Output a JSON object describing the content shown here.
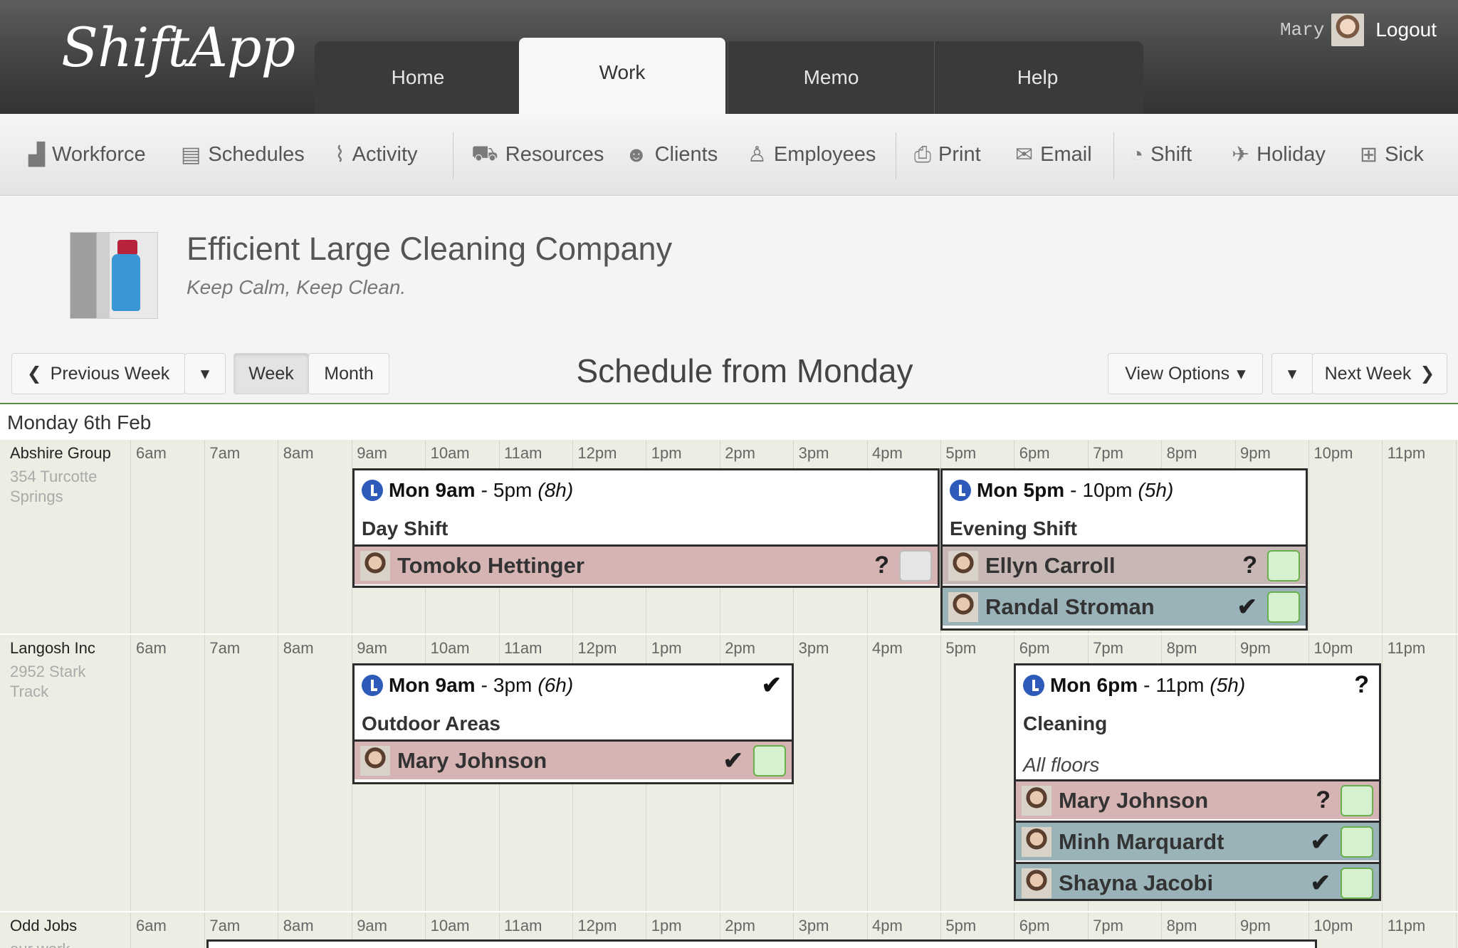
{
  "app": {
    "logo": "ShiftApp",
    "user_name": "Mary",
    "logout": "Logout"
  },
  "tabs": [
    {
      "label": "Home"
    },
    {
      "label": "Work"
    },
    {
      "label": "Memo"
    },
    {
      "label": "Help"
    }
  ],
  "toolbar": [
    {
      "label": "Workforce",
      "icon": "factory-icon"
    },
    {
      "label": "Schedules",
      "icon": "clipboard-icon"
    },
    {
      "label": "Activity",
      "icon": "pulse-icon"
    },
    {
      "label": "Resources",
      "icon": "truck-icon"
    },
    {
      "label": "Clients",
      "icon": "client-icon"
    },
    {
      "label": "Employees",
      "icon": "user-icon"
    },
    {
      "label": "Print",
      "icon": "print-icon"
    },
    {
      "label": "Email",
      "icon": "envelope-icon"
    },
    {
      "label": "Shift",
      "icon": "clock-icon"
    },
    {
      "label": "Holiday",
      "icon": "plane-icon"
    },
    {
      "label": "Sick",
      "icon": "medkit-icon"
    }
  ],
  "company": {
    "name": "Efficient Large Cleaning Company",
    "slogan": "Keep Calm, Keep Clean."
  },
  "nav": {
    "previous": "Previous Week",
    "week": "Week",
    "month": "Month",
    "title": "Schedule from Monday",
    "view_options": "View Options",
    "next": "Next Week"
  },
  "day_label": "Monday 6th Feb",
  "hours": [
    "6am",
    "7am",
    "8am",
    "9am",
    "10am",
    "11am",
    "12pm",
    "1pm",
    "2pm",
    "3pm",
    "4pm",
    "5pm",
    "6pm",
    "7pm",
    "8pm",
    "9pm",
    "10pm",
    "11pm"
  ],
  "clients": [
    {
      "name": "Abshire Group",
      "address": "354 Turcotte Springs"
    },
    {
      "name": "Langosh Inc",
      "address": "2952 Stark Track"
    },
    {
      "name": "Odd Jobs",
      "address": "our work"
    }
  ],
  "shifts": {
    "day": {
      "day": "Mon",
      "start": "9am",
      "end": "5pm",
      "duration": "(8h)",
      "name": "Day Shift",
      "employees": [
        {
          "name": "Tomoko Hettinger",
          "status": "?"
        }
      ]
    },
    "evening": {
      "day": "Mon",
      "start": "5pm",
      "end": "10pm",
      "duration": "(5h)",
      "name": "Evening Shift",
      "employees": [
        {
          "name": "Ellyn Carroll",
          "status": "?"
        },
        {
          "name": "Randal Stroman",
          "status": "✔"
        }
      ]
    },
    "outdoor": {
      "day": "Mon",
      "start": "9am",
      "end": "3pm",
      "duration": "(6h)",
      "name": "Outdoor Areas",
      "flag": "✔",
      "employees": [
        {
          "name": "Mary Johnson",
          "status": "✔"
        }
      ]
    },
    "cleaning": {
      "day": "Mon",
      "start": "6pm",
      "end": "11pm",
      "duration": "(5h)",
      "name": "Cleaning",
      "note": "All floors",
      "flag": "?",
      "employees": [
        {
          "name": "Mary Johnson",
          "status": "?"
        },
        {
          "name": "Minh Marquardt",
          "status": "✔"
        },
        {
          "name": "Shayna Jacobi",
          "status": "✔"
        }
      ]
    }
  }
}
